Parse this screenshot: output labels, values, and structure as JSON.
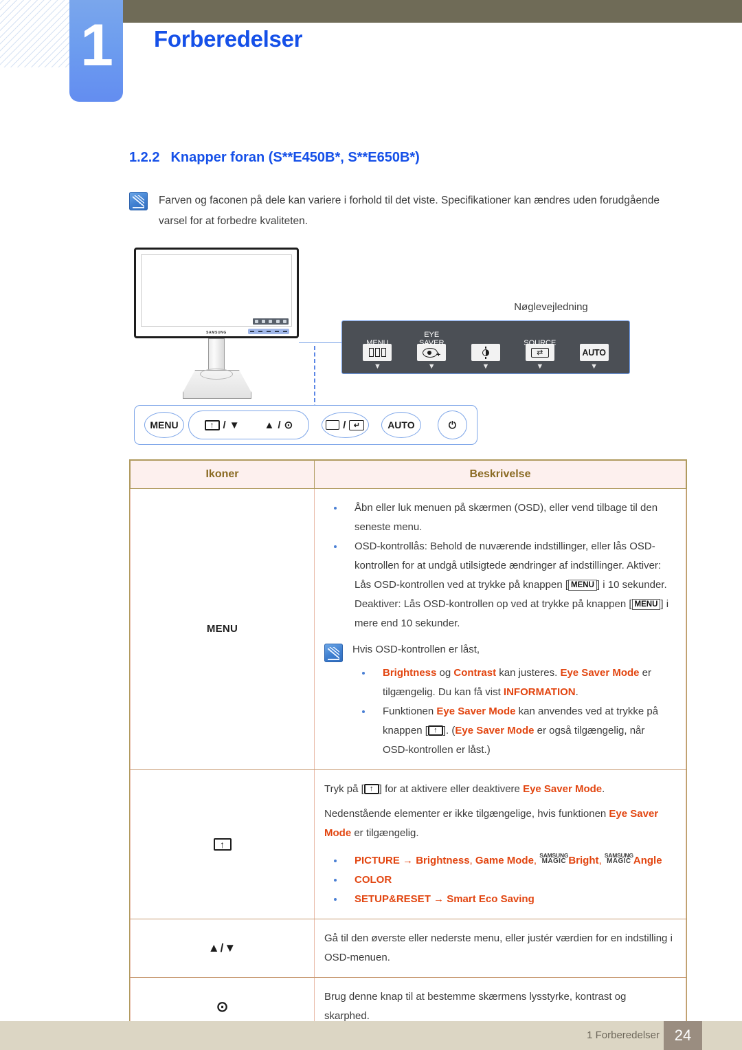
{
  "header": {
    "chapter_number": "1",
    "chapter_title": "Forberedelser"
  },
  "section": {
    "number": "1.2.2",
    "title": "Knapper foran (S**E450B*, S**E650B*)"
  },
  "note": {
    "text": "Farven og faconen på dele kan variere i forhold til det viste. Specifikationer kan ændres uden forudgående varsel for at forbedre kvaliteten."
  },
  "illustration": {
    "key_guide_title": "Nøglevejledning",
    "key_guide_buttons": [
      {
        "label": "MENU",
        "icon": "menu-bars-icon"
      },
      {
        "label": "EYE\nSAVER",
        "icon": "eye-saver-icon"
      },
      {
        "label": "",
        "icon": "brightness-icon"
      },
      {
        "label": "SOURCE",
        "icon": "source-icon"
      },
      {
        "label": "",
        "icon": "auto-icon",
        "text": "AUTO"
      }
    ],
    "physical_buttons": {
      "menu": "MENU",
      "dual_left": "/",
      "dual_right": "/",
      "auto": "AUTO",
      "power": "⏻"
    }
  },
  "table": {
    "headers": {
      "icons": "Ikoner",
      "description": "Beskrivelse"
    },
    "rows": [
      {
        "icon_label": "MENU",
        "icon_type": "text",
        "bullets": [
          "Åbn eller luk menuen på skærmen (OSD), eller vend tilbage til den seneste menu.",
          "OSD-kontrollås: Behold de nuværende indstillinger, eller lås OSD-kontrollen for at undgå utilsigtede ændringer af indstillinger. Aktiver: Lås OSD-kontrollen ved at trykke på knappen [MENU] i 10 sekunder. Deaktiver: Lås OSD-kontrollen op ved at trykke på knappen [MENU] i mere end 10 sekunder."
        ],
        "subnote": {
          "intro": "Hvis OSD-kontrollen er låst,",
          "items": [
            "Brightness og Contrast kan justeres. Eye Saver Mode er tilgængelig. Du kan få vist INFORMATION.",
            "Funktionen Eye Saver Mode kan anvendes ved at trykke på knappen [ ]. (Eye Saver Mode er også tilgængelig, når OSD-kontrollen er låst.)"
          ]
        }
      },
      {
        "icon_label": "",
        "icon_type": "eye-saver-box",
        "paragraphs": [
          "Tryk på [ ] for at aktivere eller deaktivere Eye Saver Mode.",
          "Nedenstående elementer er ikke tilgængelige, hvis funktionen Eye Saver Mode er tilgængelig."
        ],
        "bullets": [
          "PICTURE → Brightness, Game Mode, SAMSUNG MAGIC Bright, SAMSUNG MAGIC Angle",
          "COLOR",
          "SETUP&RESET → Smart Eco Saving"
        ]
      },
      {
        "icon_label": "▲/▼",
        "icon_type": "arrows",
        "text": "Gå til den øverste eller nederste menu, eller justér værdien for en indstilling i OSD-menuen."
      },
      {
        "icon_label": "⊙",
        "icon_type": "dot",
        "text": "Brug denne knap til at bestemme skærmens lysstyrke, kontrast og skarphed."
      }
    ],
    "row1_text": {
      "b1": "Åbn eller luk menuen på skærmen (OSD), eller vend tilbage til den seneste menu.",
      "b2_p1": "OSD-kontrollås: Behold de nuværende indstillinger, eller lås OSD-kontrollen for at undgå utilsigtede ændringer af indstillinger. Aktiver: Lås OSD-kontrollen ved at trykke på knappen [",
      "b2_kbd1": "MENU",
      "b2_p2": "] i 10 sekunder. Deaktiver: Lås OSD-kontrollen op ved at trykke på knappen [",
      "b2_kbd2": "MENU",
      "b2_p3": "] i mere end 10 sekunder.",
      "note_intro": "Hvis OSD-kontrollen er låst,",
      "n1_w1": "Brightness",
      "n1_w2": " og ",
      "n1_w3": "Contrast",
      "n1_w4": " kan justeres. ",
      "n1_w5": "Eye Saver Mode",
      "n1_w6": " er tilgængelig. Du kan få vist ",
      "n1_w7": "INFORMATION",
      "n1_w8": ".",
      "n2_w1": "Funktionen ",
      "n2_w2": "Eye Saver Mode",
      "n2_w3": " kan anvendes ved at trykke på knappen [",
      "n2_w4": "]. (",
      "n2_w5": "Eye Saver Mode",
      "n2_w6": " er også tilgængelig, når OSD-kontrollen er låst.)"
    },
    "row2_text": {
      "p1_a": "Tryk på [",
      "p1_b": "] for at aktivere eller deaktivere ",
      "p1_c": "Eye Saver Mode",
      "p1_d": ".",
      "p2_a": "Nedenstående elementer er ikke tilgængelige, hvis funktionen ",
      "p2_b": "Eye Saver Mode",
      "p2_c": " er tilgængelig.",
      "b1_a": "PICTURE",
      "b1_arrow": " → ",
      "b1_b": "Brightness",
      "b1_c": ", ",
      "b1_d": "Game Mode",
      "b1_e": ", ",
      "magic_top": "SAMSUNG",
      "magic_bot": "MAGIC",
      "b1_f": "Bright",
      "b1_g": ", ",
      "b1_h": "Angle",
      "b2": "COLOR",
      "b3_a": "SETUP&RESET",
      "b3_arrow": " → ",
      "b3_b": "Smart Eco Saving"
    },
    "row3_text": "Gå til den øverste eller nederste menu, eller justér værdien for en indstilling i OSD-menuen.",
    "row4_text": "Brug denne knap til at bestemme skærmens lysstyrke, kontrast og skarphed."
  },
  "footer": {
    "text": "1 Forberedelser",
    "page": "24"
  },
  "colors": {
    "heading_blue": "#1550e8",
    "accent_red": "#e24510",
    "header_bar": "#6f6b57",
    "table_border": "#b09a5e",
    "footer_bg": "#dcd6c4",
    "page_badge": "#9a8d80"
  }
}
